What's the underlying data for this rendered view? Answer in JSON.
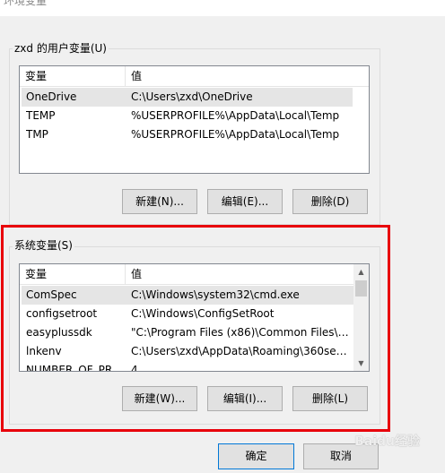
{
  "window": {
    "title": "环境变量"
  },
  "user_vars": {
    "group_label": "zxd 的用户变量(U)",
    "columns": [
      "变量",
      "值"
    ],
    "rows": [
      {
        "name": "OneDrive",
        "value": "C:\\Users\\zxd\\OneDrive",
        "selected": true
      },
      {
        "name": "TEMP",
        "value": "%USERPROFILE%\\AppData\\Local\\Temp",
        "selected": false
      },
      {
        "name": "TMP",
        "value": "%USERPROFILE%\\AppData\\Local\\Temp",
        "selected": false
      }
    ],
    "buttons": {
      "new": "新建(N)...",
      "edit": "编辑(E)...",
      "delete": "删除(D)"
    }
  },
  "system_vars": {
    "group_label": "系统变量(S)",
    "columns": [
      "变量",
      "值"
    ],
    "rows": [
      {
        "name": "ComSpec",
        "value": "C:\\Windows\\system32\\cmd.exe",
        "selected": true
      },
      {
        "name": "configsetroot",
        "value": "C:\\Windows\\ConfigSetRoot",
        "selected": false
      },
      {
        "name": "easyplussdk",
        "value": "\"C:\\Program Files (x86)\\Common Files\\l...",
        "selected": false
      },
      {
        "name": "lnkenv",
        "value": "C:\\Users\\zxd\\AppData\\Roaming\\360se6...",
        "selected": false
      },
      {
        "name": "NUMBER_OF_PR...",
        "value": "4",
        "selected": false
      }
    ],
    "buttons": {
      "new": "新建(W)...",
      "edit": "编辑(I)...",
      "delete": "删除(L)"
    }
  },
  "dialog_buttons": {
    "ok": "确定",
    "cancel": "取消"
  },
  "watermark": "Baidu经验",
  "colors": {
    "highlight": "#e8000b",
    "selected_row": "#e5e5e5"
  }
}
